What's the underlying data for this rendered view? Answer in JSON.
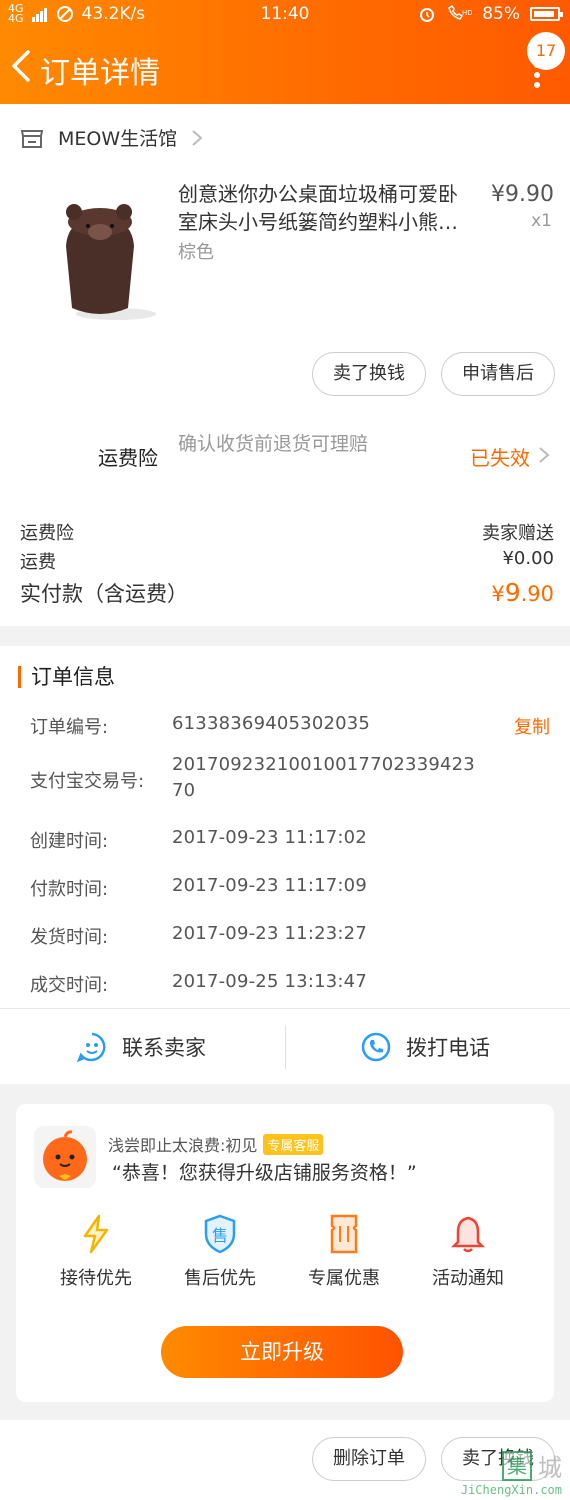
{
  "status_bar": {
    "network": "4G 4G",
    "speed": "43.2K/s",
    "time": "11:40",
    "battery": "85%"
  },
  "nav": {
    "title": "订单详情",
    "badge": "17"
  },
  "shop": {
    "name": "MEOW生活馆"
  },
  "product": {
    "title": "创意迷你办公桌面垃圾桶可爱卧室床头小号纸篓简约塑料小熊…",
    "spec": "棕色",
    "price": "¥9.90",
    "qty": "x1",
    "btn_sell": "卖了换钱",
    "btn_aftersale": "申请售后"
  },
  "insurance": {
    "label": "运费险",
    "desc": "确认收货前退货可理赔",
    "status": "已失效"
  },
  "fees": [
    {
      "label": "运费险",
      "value": "卖家赠送"
    },
    {
      "label": "运费",
      "value": "¥0.00"
    }
  ],
  "paid": {
    "label": "实付款（含运费）",
    "symbol": "¥",
    "int": "9",
    "dec": ".90"
  },
  "order_info": {
    "title": "订单信息",
    "copy_label": "复制",
    "rows": [
      {
        "label": "订单编号:",
        "value": "61338369405302035"
      },
      {
        "label": "支付宝交易号:",
        "value": "2017092321001001770233942370"
      },
      {
        "label": "创建时间:",
        "value": "2017-09-23 11:17:02"
      },
      {
        "label": "付款时间:",
        "value": "2017-09-23 11:17:09"
      },
      {
        "label": "发货时间:",
        "value": "2017-09-23 11:23:27"
      },
      {
        "label": "成交时间:",
        "value": "2017-09-25 13:13:47"
      }
    ]
  },
  "contact": {
    "seller": "联系卖家",
    "phone": "拨打电话"
  },
  "promo": {
    "name": "浅尝即止太浪费:初见",
    "tag": "专属客服",
    "message": "“恭喜！您获得升级店铺服务资格！”",
    "perks": [
      {
        "label": "接待优先",
        "icon": "lightning-icon"
      },
      {
        "label": "售后优先",
        "icon": "shield-icon"
      },
      {
        "label": "专属优惠",
        "icon": "coupon-icon"
      },
      {
        "label": "活动通知",
        "icon": "bell-icon"
      }
    ],
    "upgrade": "立即升级",
    "shield_char": "售"
  },
  "bottom": {
    "delete": "删除订单",
    "sell": "卖了换钱"
  },
  "watermark": {
    "logo": "集",
    "text": "城",
    "url": "JiChengXin.com"
  },
  "colors": {
    "accent": "#ff6a00",
    "header_start": "#ff8a00",
    "link_blue": "#2a9df4"
  }
}
